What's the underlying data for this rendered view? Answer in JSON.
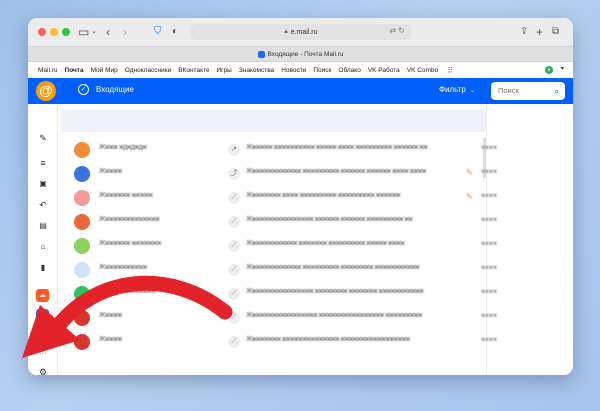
{
  "browser": {
    "address": "e.mail.ru",
    "tab_title": "Входящие - Почта Mail.ru",
    "icons": [
      "sidebar-icon",
      "back-icon",
      "forward-icon",
      "shield-icon",
      "privacy-icon",
      "translate-icon",
      "reload-icon",
      "share-icon",
      "new-tab-icon",
      "tabs-overview-icon"
    ]
  },
  "portal_nav": {
    "links": [
      "Mail.ru",
      "Почта",
      "Мой Мир",
      "Одноклассники",
      "ВКонтакте",
      "Игры",
      "Знакомства",
      "Новости",
      "Поиск",
      "Облако",
      "VK Работа",
      "VK Combo"
    ],
    "active_index": 1
  },
  "header": {
    "logo": "@",
    "folder_title": "Входящие",
    "filter_label": "Фильтр",
    "search_placeholder": "Поиск",
    "brand_color": "#005ff9"
  },
  "sidebar": {
    "items": [
      "compose-icon",
      "menu-icon",
      "inbox-icon",
      "reply-icon",
      "drafts-icon",
      "archive-icon",
      "trash-icon"
    ],
    "apps": [
      {
        "name": "cloud-app-icon",
        "color": "#ff5a1f"
      },
      {
        "name": "profile-app-icon",
        "color": "#1e6cf5"
      },
      {
        "name": "calendar-app-icon",
        "label": "23",
        "color": "#1e6cf5"
      }
    ],
    "more": "···",
    "settings": "settings-icon"
  },
  "emails": [
    {
      "avatar_color": "#f28c38",
      "sender": "Жжжж ждждждж",
      "subject": "Жжжжжж жжжжжжжжжж жжжжж жжжж жжжжжжжжж жжжжжж жж",
      "attachment": false,
      "date": "жжжж"
    },
    {
      "avatar_color": "#3b72e0",
      "sender": "Жжжжж",
      "subject": "Жжжжжжжжжжжжж жжжжжжжжж жжжжжж жжжжжж жжжж жжжж",
      "attachment": true,
      "date": "жжжж"
    },
    {
      "avatar_color": "#f49b9b",
      "sender": "Жжжжжжж жжжжж",
      "subject": "Жжжжжжжж жжжж жжжжжжжжж жжжжжжжжж жжжжжж",
      "attachment": true,
      "date": "жжжж"
    },
    {
      "avatar_color": "#e9683a",
      "sender": "Жжжжжжжжжжжжжж",
      "subject": "Жжжжжжжжжжжжжжжж жжжжжж жжжжжж жжжжжжжжж жж",
      "attachment": false,
      "date": "жжжж"
    },
    {
      "avatar_color": "#8bd35c",
      "sender": "Жжжжжжж жжжжжжж",
      "subject": "Жжжжжжжжжжжж жжжжжжж жжжжжжжжж жжжжж жжжж",
      "attachment": false,
      "date": "жжжж"
    },
    {
      "avatar_color": "#cfe3f6",
      "sender": "Жжжжжжжжжжж",
      "subject": "Жжжжжжжжжжжжж жжжжжжжжж жжжжжжжж жжжжжжжжжжж",
      "attachment": false,
      "date": "жжжж"
    },
    {
      "avatar_color": "#2bc55e",
      "sender": "Жжжжжжжжжжжжж",
      "subject": "Жжжжжжжжжжжжжжжж жжжжжжжж жжжжжжж жжжжжжжжжжж",
      "attachment": false,
      "date": "жжжж"
    },
    {
      "avatar_color": "#d8352f",
      "sender": "Жжжжж",
      "subject": "Жжжжжжжжжжжжжжжжж жжжжжжжжжжжжжжжж жжжжжжжжж",
      "attachment": false,
      "date": "жжжж"
    },
    {
      "avatar_color": "#d8352f",
      "sender": "Жжжжж",
      "subject": "Жжжжжжжж жжжжжжжжжжжжжж жжжжжжжжжжжжжжжжж",
      "attachment": false,
      "date": "жжжж"
    }
  ],
  "annotation": {
    "arrow_color": "#e3232a"
  }
}
